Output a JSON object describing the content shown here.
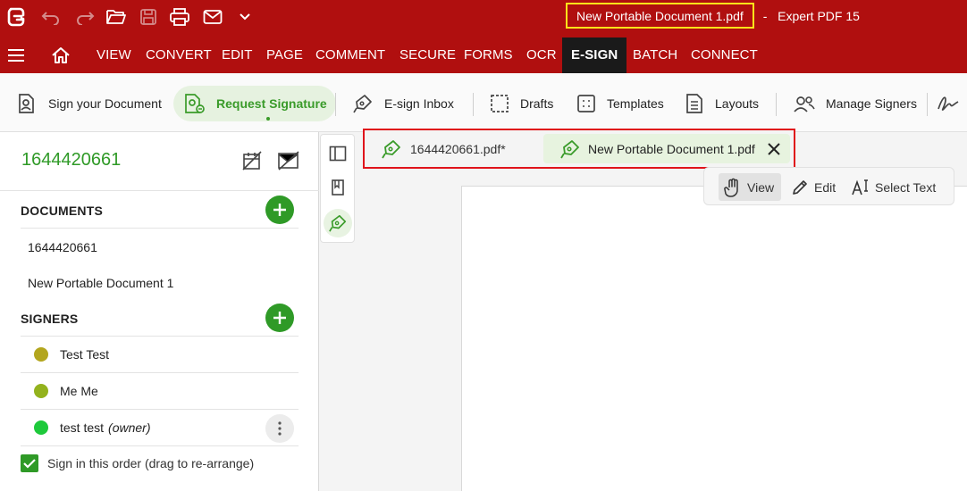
{
  "window": {
    "document_title": "New Portable Document 1.pdf",
    "separator": "-",
    "app_title": "Expert PDF 15"
  },
  "menu": {
    "tabs": [
      "VIEW",
      "CONVERT",
      "EDIT",
      "PAGE",
      "COMMENT",
      "SECURE",
      "FORMS",
      "OCR",
      "E-SIGN",
      "BATCH",
      "CONNECT"
    ],
    "active_tab": "E-SIGN"
  },
  "ribbon": {
    "sign_document": "Sign your Document",
    "request_signature": "Request Signature",
    "esign_inbox": "E-sign Inbox",
    "drafts": "Drafts",
    "templates": "Templates",
    "layouts": "Layouts",
    "manage_signers": "Manage Signers"
  },
  "panel": {
    "title": "1644420661",
    "documents_label": "DOCUMENTS",
    "documents": [
      "1644420661",
      "New Portable Document 1"
    ],
    "signers_label": "SIGNERS",
    "signers": [
      {
        "name": "Test Test",
        "color": "#b3a61e",
        "role": ""
      },
      {
        "name": "Me Me",
        "color": "#93b21d",
        "role": ""
      },
      {
        "name": "test test",
        "color": "#1ec93b",
        "role": "(owner)"
      }
    ],
    "sign_order_label": "Sign in this order (drag to re-arrange)",
    "sign_order_checked": true
  },
  "doc_tabs": [
    {
      "label": "1644420661.pdf*",
      "active": false
    },
    {
      "label": "New Portable Document 1.pdf",
      "active": true
    }
  ],
  "modes": {
    "view": "View",
    "edit": "Edit",
    "select_text": "Select Text",
    "active": "View"
  },
  "colors": {
    "titlebar": "#b00f0f",
    "accent_green": "#2f9a27",
    "highlight_yellow": "#ffe21a",
    "highlight_red": "#e0131b"
  }
}
